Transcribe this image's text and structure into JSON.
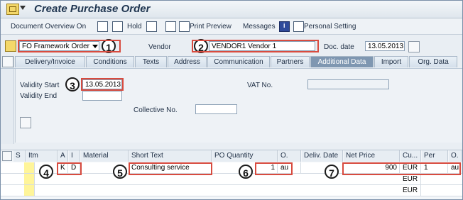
{
  "window": {
    "title": "Create Purchase Order"
  },
  "toolbar": {
    "document_overview_on": "Document Overview On",
    "hold": "Hold",
    "print_preview": "Print Preview",
    "messages": "Messages",
    "personal_setting": "Personal Setting"
  },
  "header": {
    "order_type": "FO Framework Order",
    "vendor_label": "Vendor",
    "vendor_value": "VENDOR1 Vendor 1",
    "doc_date_label": "Doc. date",
    "doc_date_value": "13.05.2013"
  },
  "tabs": [
    "Delivery/Invoice",
    "Conditions",
    "Texts",
    "Address",
    "Communication",
    "Partners",
    "Additional Data",
    "Import",
    "Org. Data"
  ],
  "additional_data": {
    "validity_start_label": "Validity Start",
    "validity_start_value": "13.05.2013",
    "validity_end_label": "Validity End",
    "collective_no_label": "Collective No.",
    "vat_no_label": "VAT No."
  },
  "items_table": {
    "headers": {
      "s": "S",
      "itm": "Itm",
      "a": "A",
      "i": "I",
      "material": "Material",
      "short_text": "Short Text",
      "po_quantity": "PO Quantity",
      "o1": "O.",
      "deliv_date": "Deliv. Date",
      "net_price": "Net Price",
      "cu": "Cu...",
      "per": "Per",
      "o2": "O."
    },
    "row1": {
      "a": "K",
      "i": "D",
      "short_text": "Consulting service",
      "po_quantity": "1",
      "oun": "au",
      "net_price": "900",
      "currency": "EUR",
      "per": "1",
      "oun2": "au"
    },
    "row2": {
      "currency": "EUR"
    },
    "row3": {
      "currency": "EUR"
    }
  },
  "callouts": [
    "1",
    "2",
    "3",
    "4",
    "5",
    "6",
    "7"
  ]
}
